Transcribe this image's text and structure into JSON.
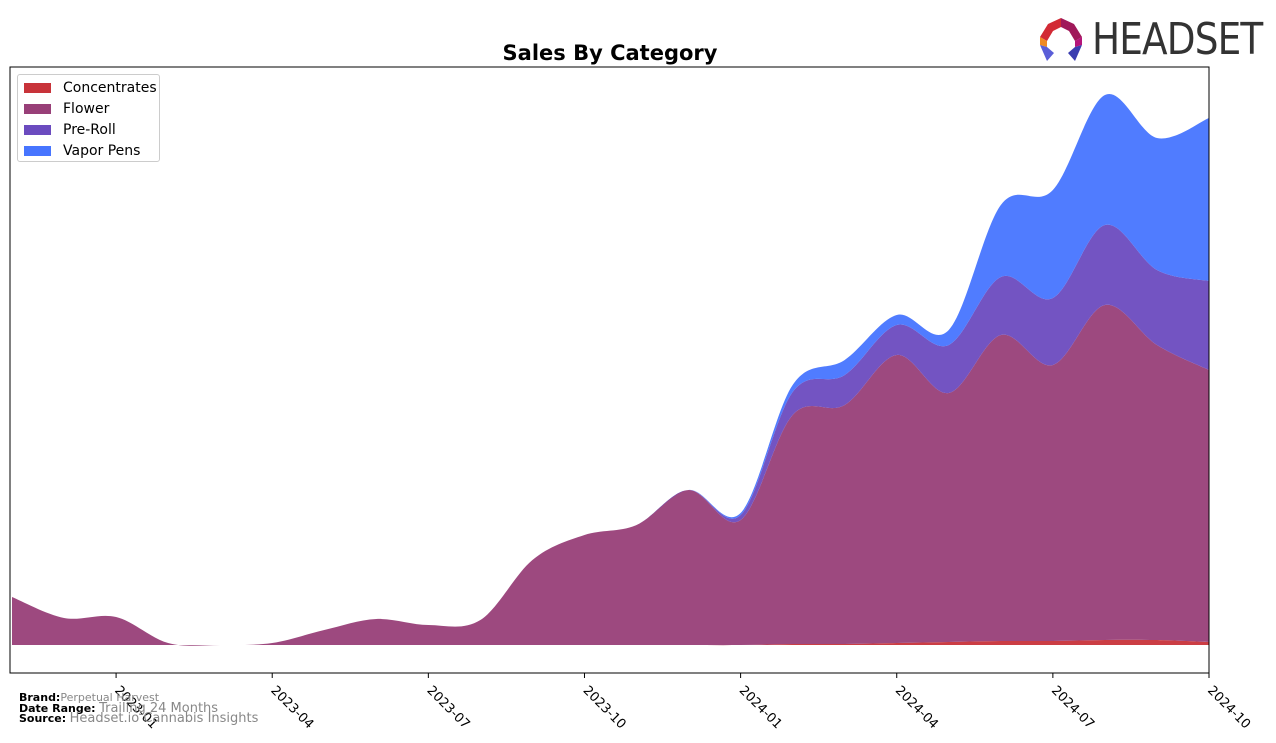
{
  "chart_data": {
    "type": "area",
    "stacked": true,
    "title": "Sales By Category",
    "xlabel": "",
    "ylabel": "",
    "x": [
      "2022-11",
      "2022-12",
      "2023-01",
      "2023-02",
      "2023-03",
      "2023-04",
      "2023-05",
      "2023-06",
      "2023-07",
      "2023-08",
      "2023-09",
      "2023-10",
      "2023-11",
      "2023-12",
      "2024-01",
      "2024-02",
      "2024-03",
      "2024-04",
      "2024-05",
      "2024-06",
      "2024-07",
      "2024-08",
      "2024-09",
      "2024-10"
    ],
    "x_ticks": [
      "2023-01",
      "2023-04",
      "2023-07",
      "2023-10",
      "2024-01",
      "2024-04",
      "2024-07",
      "2024-10"
    ],
    "ylim": [
      -28,
      578
    ],
    "y_ticks_shown": false,
    "grid": false,
    "legend_position": "top-left",
    "series": [
      {
        "name": "Concentrates",
        "color": "#c8333a",
        "values": [
          0,
          0,
          0,
          0,
          0,
          0,
          0,
          0,
          0,
          0,
          0,
          0,
          0,
          0,
          0,
          1,
          1,
          2,
          3,
          4,
          4,
          5,
          5,
          3
        ]
      },
      {
        "name": "Flower",
        "color": "#983f78",
        "values": [
          48,
          27,
          28,
          2,
          0,
          2,
          15,
          26,
          20,
          25,
          85,
          110,
          120,
          155,
          125,
          229,
          239,
          288,
          249,
          306,
          276,
          335,
          295,
          272
        ]
      },
      {
        "name": "Pre-Roll",
        "color": "#6b4bbf",
        "values": [
          0,
          0,
          0,
          0,
          0,
          0,
          0,
          0,
          0,
          0,
          0,
          0,
          0,
          0,
          5,
          23,
          30,
          30,
          48,
          58,
          67,
          80,
          75,
          89
        ]
      },
      {
        "name": "Vapor Pens",
        "color": "#4775ff",
        "values": [
          0,
          0,
          0,
          0,
          0,
          0,
          0,
          0,
          0,
          0,
          0,
          0,
          0,
          0,
          2,
          7,
          15,
          10,
          15,
          72,
          108,
          130,
          132,
          163
        ]
      }
    ]
  },
  "meta": {
    "brand_label": "Brand:",
    "brand": "Perpetual Harvest",
    "range_label": "Date Range:",
    "range": "Trailing 24 Months",
    "source_label": "Source:",
    "source": "Headset.io Cannabis Insights"
  },
  "logo": {
    "text": "HEADSET"
  }
}
